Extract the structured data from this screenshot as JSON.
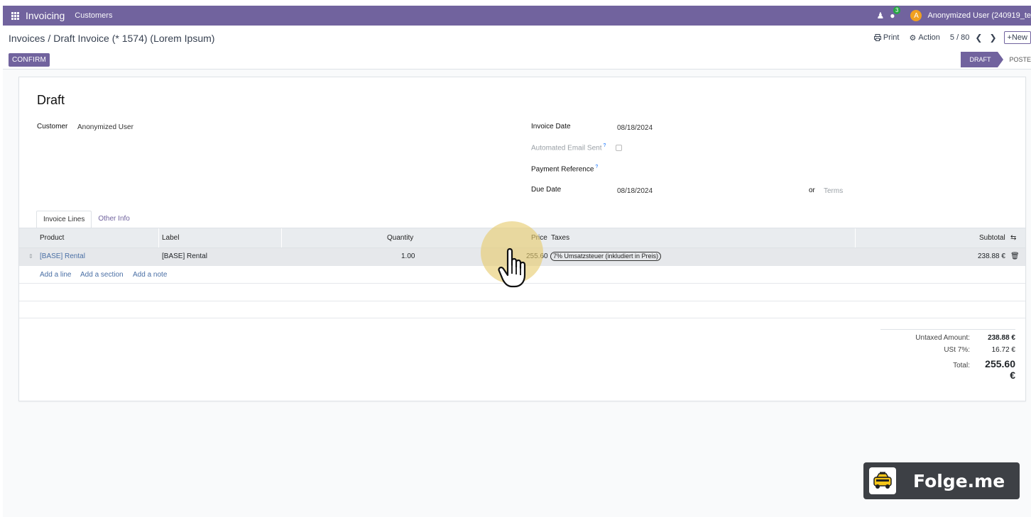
{
  "navbar": {
    "app_name": "Invoicing",
    "menu_item": "Customers",
    "chat_badge": "3",
    "user_initial": "A",
    "user_name": "Anonymized User (240919_te"
  },
  "breadcrumb": {
    "parent": "Invoices",
    "separator": "/",
    "current": "Draft Invoice (* 1574) (Lorem Ipsum)"
  },
  "toolbar": {
    "print_label": "Print",
    "action_label": "Action",
    "pager": "5 / 80",
    "new_label": "New",
    "confirm_label": "CONFIRM"
  },
  "statusbar": {
    "draft": "DRAFT",
    "posted": "POSTE"
  },
  "form": {
    "title": "Draft",
    "customer_label": "Customer",
    "customer_value": "Anonymized User",
    "invoice_date_label": "Invoice Date",
    "invoice_date_value": "08/18/2024",
    "auto_email_label": "Automated Email Sent",
    "payment_ref_label": "Payment Reference",
    "help_mark": "?",
    "due_date_label": "Due Date",
    "due_date_value": "08/18/2024",
    "or_label": "or",
    "terms_placeholder": "Terms"
  },
  "tabs": [
    "Invoice Lines",
    "Other Info"
  ],
  "table": {
    "columns": {
      "product": "Product",
      "label": "Label",
      "quantity": "Quantity",
      "price": "Price",
      "taxes": "Taxes",
      "subtotal": "Subtotal"
    },
    "rows": [
      {
        "product": "[BASE] Rental",
        "label": "[BASE] Rental",
        "quantity": "1.00",
        "price": "255.60",
        "tax": "7% Umsatzsteuer (inkludiert in Preis)",
        "subtotal": "238.88 €"
      }
    ],
    "add_line": "Add a line",
    "add_section": "Add a section",
    "add_note": "Add a note"
  },
  "totals": {
    "untaxed_label": "Untaxed Amount:",
    "untaxed_value": "238.88 €",
    "tax_label": "USt 7%:",
    "tax_value": "16.72 €",
    "total_label": "Total:",
    "total_value": "255.60 €"
  },
  "watermark": {
    "text": "Folge.me"
  },
  "colors": {
    "brand": "#71639e",
    "link": "#4a6fa5",
    "cursor_highlight": "#e7cc6e"
  }
}
